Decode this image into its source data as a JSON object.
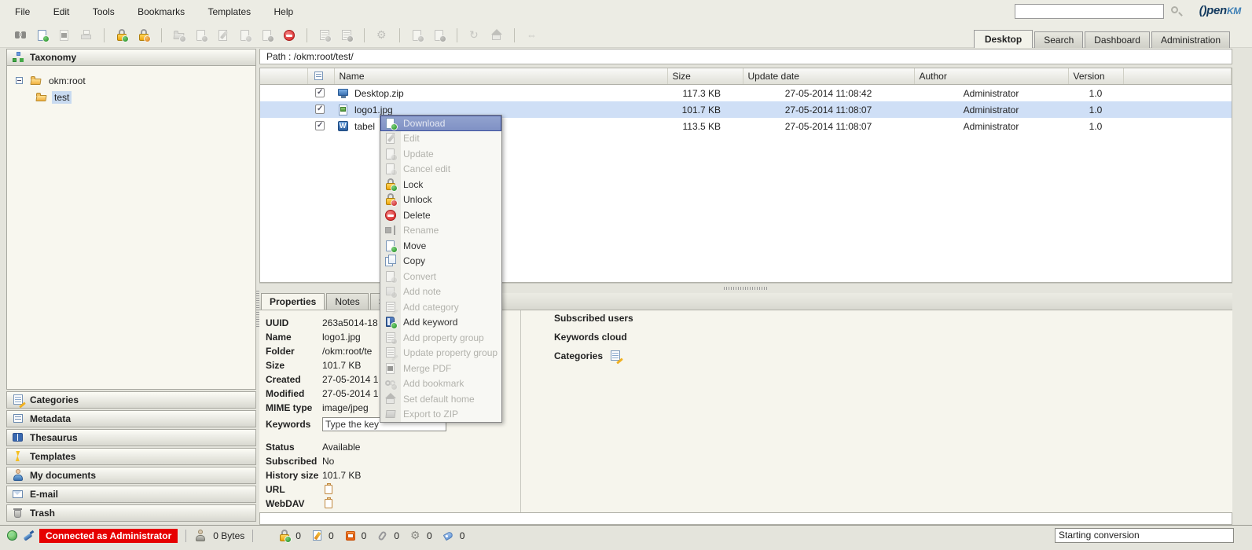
{
  "menubar": {
    "items": [
      "File",
      "Edit",
      "Tools",
      "Bookmarks",
      "Templates",
      "Help"
    ],
    "search_value": "",
    "logo_text": "()pen",
    "logo_suffix": "KM"
  },
  "view_tabs": [
    {
      "label": "Desktop",
      "active": true
    },
    {
      "label": "Search",
      "active": false
    },
    {
      "label": "Dashboard",
      "active": false
    },
    {
      "label": "Administration",
      "active": false
    }
  ],
  "toolbar_icons": [
    "find",
    "download",
    "convert-pdf",
    "print",
    "lock",
    "unlock",
    "create-folder",
    "create-document",
    "edit-document",
    "checkout-document",
    "checkin-document",
    "delete",
    "add-property-group",
    "remove-property-group",
    "start-workflow",
    "add-subscription",
    "remove-subscription",
    "refresh",
    "home",
    "horizontal-resize"
  ],
  "sidebar": {
    "taxonomy_label": "Taxonomy",
    "tree": {
      "root": "okm:root",
      "child": "test",
      "child_selected": true
    },
    "sections": [
      "Categories",
      "Metadata",
      "Thesaurus",
      "Templates",
      "My documents",
      "E-mail",
      "Trash"
    ]
  },
  "main": {
    "path": "Path : /okm:root/test/"
  },
  "file_table": {
    "columns": [
      "Name",
      "Size",
      "Update date",
      "Author",
      "Version"
    ],
    "rows": [
      {
        "name": "Desktop.zip",
        "size": "117.3 KB",
        "update_date": "27-05-2014 11:08:42",
        "author": "Administrator",
        "version": "1.0",
        "icon": "archive",
        "checked": true,
        "selected": false
      },
      {
        "name": "logo1.jpg",
        "size": "101.7 KB",
        "update_date": "27-05-2014 11:08:07",
        "author": "Administrator",
        "version": "1.0",
        "icon": "image",
        "checked": true,
        "selected": true
      },
      {
        "name": "tabel",
        "size": "113.5 KB",
        "update_date": "27-05-2014 11:08:07",
        "author": "Administrator",
        "version": "1.0",
        "icon": "word-document",
        "checked": true,
        "selected": false
      }
    ]
  },
  "context_menu": {
    "items": [
      {
        "label": "Download",
        "enabled": true,
        "highlighted": true,
        "icon": "download"
      },
      {
        "label": "Edit",
        "enabled": false,
        "icon": "edit"
      },
      {
        "label": "Update",
        "enabled": false,
        "icon": "update"
      },
      {
        "label": "Cancel edit",
        "enabled": false,
        "icon": "cancel-edit"
      },
      {
        "label": "Lock",
        "enabled": true,
        "icon": "lock"
      },
      {
        "label": "Unlock",
        "enabled": true,
        "icon": "unlock"
      },
      {
        "label": "Delete",
        "enabled": true,
        "icon": "delete"
      },
      {
        "label": "Rename",
        "enabled": false,
        "icon": "rename"
      },
      {
        "label": "Move",
        "enabled": true,
        "icon": "move"
      },
      {
        "label": "Copy",
        "enabled": true,
        "icon": "copy"
      },
      {
        "label": "Convert",
        "enabled": false,
        "icon": "convert"
      },
      {
        "label": "Add note",
        "enabled": false,
        "icon": "add-note"
      },
      {
        "label": "Add category",
        "enabled": false,
        "icon": "add-category"
      },
      {
        "label": "Add keyword",
        "enabled": true,
        "icon": "add-keyword"
      },
      {
        "label": "Add property group",
        "enabled": false,
        "icon": "add-property-group"
      },
      {
        "label": "Update property group",
        "enabled": false,
        "icon": "update-property-group"
      },
      {
        "label": "Merge PDF",
        "enabled": false,
        "icon": "merge-pdf"
      },
      {
        "label": "Add bookmark",
        "enabled": false,
        "icon": "add-bookmark"
      },
      {
        "label": "Set default home",
        "enabled": false,
        "icon": "set-default-home"
      },
      {
        "label": "Export to ZIP",
        "enabled": false,
        "icon": "export-zip"
      }
    ]
  },
  "properties": {
    "tabs": [
      {
        "label": "Properties",
        "active": true
      },
      {
        "label": "Notes",
        "active": false
      },
      {
        "label": "Sec",
        "active": false
      }
    ],
    "fields": [
      {
        "label": "UUID",
        "value": "263a5014-18"
      },
      {
        "label": "Name",
        "value": "logo1.jpg"
      },
      {
        "label": "Folder",
        "value": "/okm:root/te"
      },
      {
        "label": "Size",
        "value": "101.7 KB"
      },
      {
        "label": "Created",
        "value": "27-05-2014 1"
      },
      {
        "label": "Modified",
        "value": "27-05-2014 1"
      },
      {
        "label": "MIME type",
        "value": "image/jpeg"
      }
    ],
    "keywords_label": "Keywords",
    "keywords_value": "Type the key",
    "fields2": [
      {
        "label": "Status",
        "value": "Available"
      },
      {
        "label": "Subscribed",
        "value": "No"
      },
      {
        "label": "History size",
        "value": "101.7 KB"
      }
    ],
    "url_label": "URL",
    "webdav_label": "WebDAV"
  },
  "right_panel": {
    "subscribed_users": "Subscribed users",
    "keywords_cloud": "Keywords cloud",
    "categories": "Categories"
  },
  "status_bar": {
    "connection": "Connected as Administrator",
    "quota": "0 Bytes",
    "counters": [
      {
        "icon": "locked-documents",
        "count": "0"
      },
      {
        "icon": "checkout-documents",
        "count": "0"
      },
      {
        "icon": "subscriptions",
        "count": "0"
      },
      {
        "icon": "attachments",
        "count": "0"
      },
      {
        "icon": "workflows",
        "count": "0"
      },
      {
        "icon": "keywords",
        "count": "0"
      }
    ],
    "message": "Starting conversion"
  },
  "colors": {
    "selection_blue": "#cfdff6",
    "menu_highlight": "#8394c7",
    "connection_badge_red": "#e60000",
    "background": "#e4e4dc"
  }
}
